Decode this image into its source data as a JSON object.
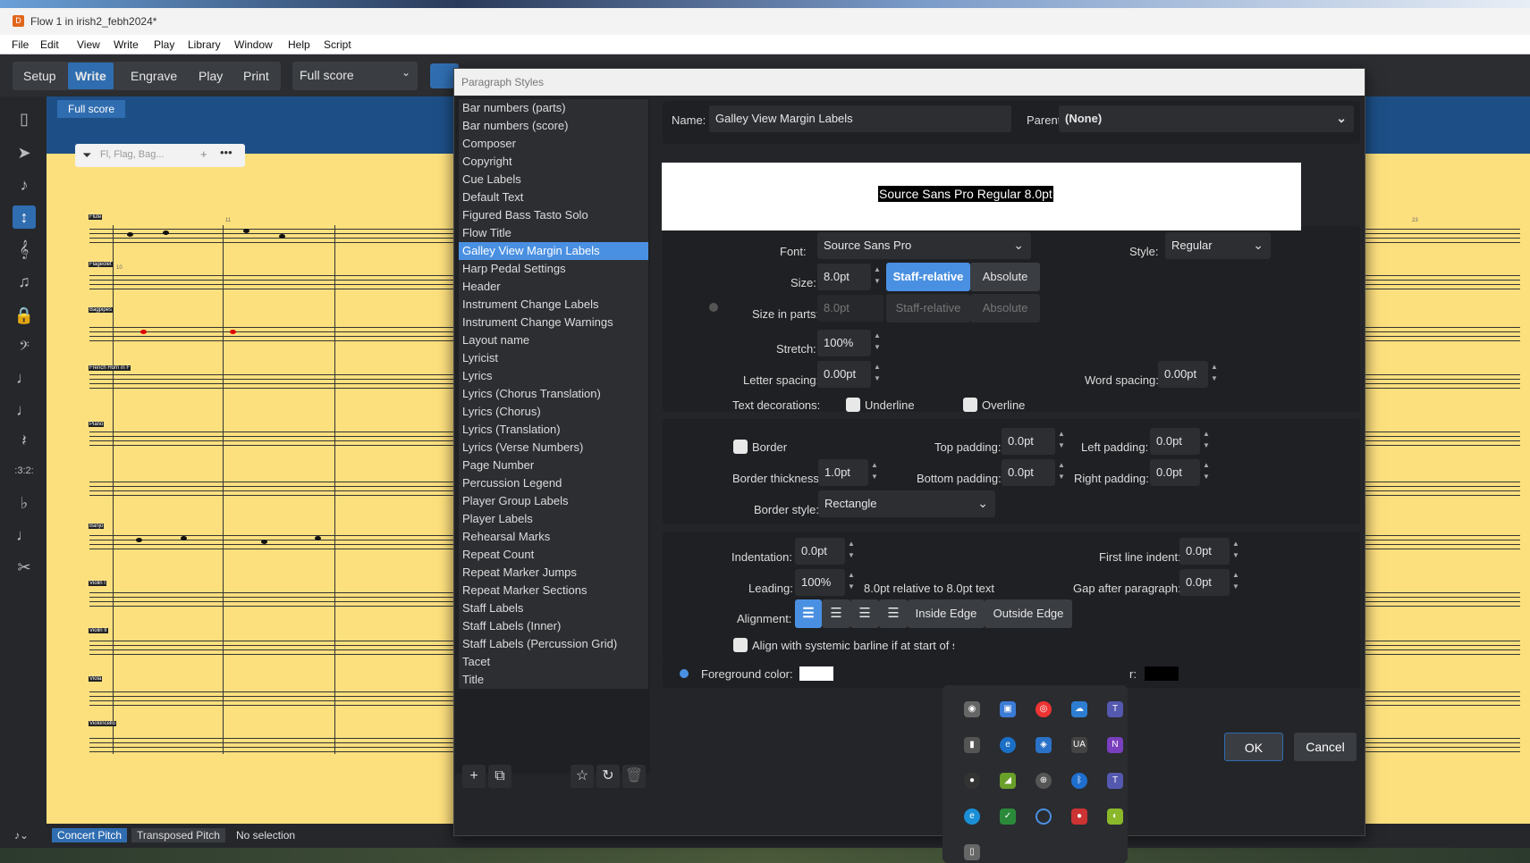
{
  "window": {
    "title": "Flow 1 in irish2_febh2024*"
  },
  "menu": [
    "File",
    "Edit",
    "View",
    "Write",
    "Play",
    "Library",
    "Window",
    "Help",
    "Script"
  ],
  "modes": [
    "Setup",
    "Write",
    "Engrave",
    "Play",
    "Print"
  ],
  "active_mode": "Write",
  "layout_select": "Full score",
  "score_tab": "Full score",
  "filter_placeholder": "Fl, Flag, Bag...",
  "instruments": [
    "Flute",
    "Flageolet",
    "Bagpipes",
    "French Horn in F",
    "Piano",
    "Banjo",
    "Violin I",
    "Violin II",
    "Viola",
    "Violoncello"
  ],
  "bar_numbers": [
    "10",
    "11",
    "23"
  ],
  "statusbar": {
    "concert": "Concert Pitch",
    "transposed": "Transposed Pitch",
    "selection": "No selection"
  },
  "dialog": {
    "title": "Paragraph Styles",
    "styles": [
      "Bar numbers (parts)",
      "Bar numbers (score)",
      "Composer",
      "Copyright",
      "Cue Labels",
      "Default Text",
      "Figured Bass Tasto Solo",
      "Flow Title",
      "Galley View Margin Labels",
      "Harp Pedal Settings",
      "Header",
      "Instrument Change Labels",
      "Instrument Change Warnings",
      "Layout name",
      "Lyricist",
      "Lyrics",
      "Lyrics (Chorus Translation)",
      "Lyrics (Chorus)",
      "Lyrics (Translation)",
      "Lyrics (Verse Numbers)",
      "Page Number",
      "Percussion Legend",
      "Player Group Labels",
      "Player Labels",
      "Rehearsal Marks",
      "Repeat Count",
      "Repeat Marker Jumps",
      "Repeat Marker Sections",
      "Staff Labels",
      "Staff Labels (Inner)",
      "Staff Labels (Percussion Grid)",
      "Tacet",
      "Title"
    ],
    "selected_style": "Galley View Margin Labels",
    "name_label": "Name:",
    "name_value": "Galley View Margin Labels",
    "parent_label": "Parent:",
    "parent_value": "(None)",
    "preview_text": "Source Sans Pro Regular 8.0pt",
    "font_label": "Font:",
    "font_value": "Source Sans Pro",
    "style_label": "Style:",
    "style_value": "Regular",
    "size_label": "Size:",
    "size_value": "8.0pt",
    "staff_relative": "Staff-relative",
    "absolute": "Absolute",
    "size_parts_label": "Size in parts:",
    "size_parts_value": "8.0pt",
    "stretch_label": "Stretch:",
    "stretch_value": "100%",
    "letter_spacing_label": "Letter spacing:",
    "letter_spacing_value": "0.00pt",
    "word_spacing_label": "Word spacing:",
    "word_spacing_value": "0.00pt",
    "text_decorations_label": "Text decorations:",
    "underline": "Underline",
    "overline": "Overline",
    "border": "Border",
    "top_padding_label": "Top padding:",
    "top_padding": "0.0pt",
    "left_padding_label": "Left padding:",
    "left_padding": "0.0pt",
    "border_thickness_label": "Border thickness:",
    "border_thickness": "1.0pt",
    "bottom_padding_label": "Bottom padding:",
    "bottom_padding": "0.0pt",
    "right_padding_label": "Right padding:",
    "right_padding": "0.0pt",
    "border_style_label": "Border style:",
    "border_style": "Rectangle",
    "indentation_label": "Indentation:",
    "indentation": "0.0pt",
    "first_line_indent_label": "First line indent:",
    "first_line_indent": "0.0pt",
    "leading_label": "Leading:",
    "leading": "100%",
    "leading_note": "8.0pt relative to 8.0pt text",
    "gap_after_label": "Gap after paragraph:",
    "gap_after": "0.0pt",
    "alignment_label": "Alignment:",
    "inside_edge": "Inside Edge",
    "outside_edge": "Outside Edge",
    "align_systemic": "Align with systemic barline if at start of syst",
    "fg_color_label": "Foreground color:",
    "bg_color_label_partial": "r:",
    "ok": "OK",
    "cancel": "Cancel"
  },
  "colors": {
    "accent": "#4a90e2",
    "mode_active": "#2f6db0",
    "score_bg": "#fde07e",
    "fg_swatch": "#ffffff",
    "bg_swatch": "#000000"
  },
  "tray_icons": [
    "camera-icon",
    "photos-icon",
    "chrome-icon",
    "onedrive-icon",
    "teams-icon",
    "app-icon",
    "edge-dev-icon",
    "defender-icon",
    "ua-icon",
    "onenote-icon",
    "obs-icon",
    "nvidia-icon",
    "network-icon",
    "bluetooth-icon",
    "teams-icon-2",
    "edge-icon",
    "security-icon",
    "circle-icon",
    "record-icon",
    "greenshot-icon",
    "usb-icon"
  ]
}
